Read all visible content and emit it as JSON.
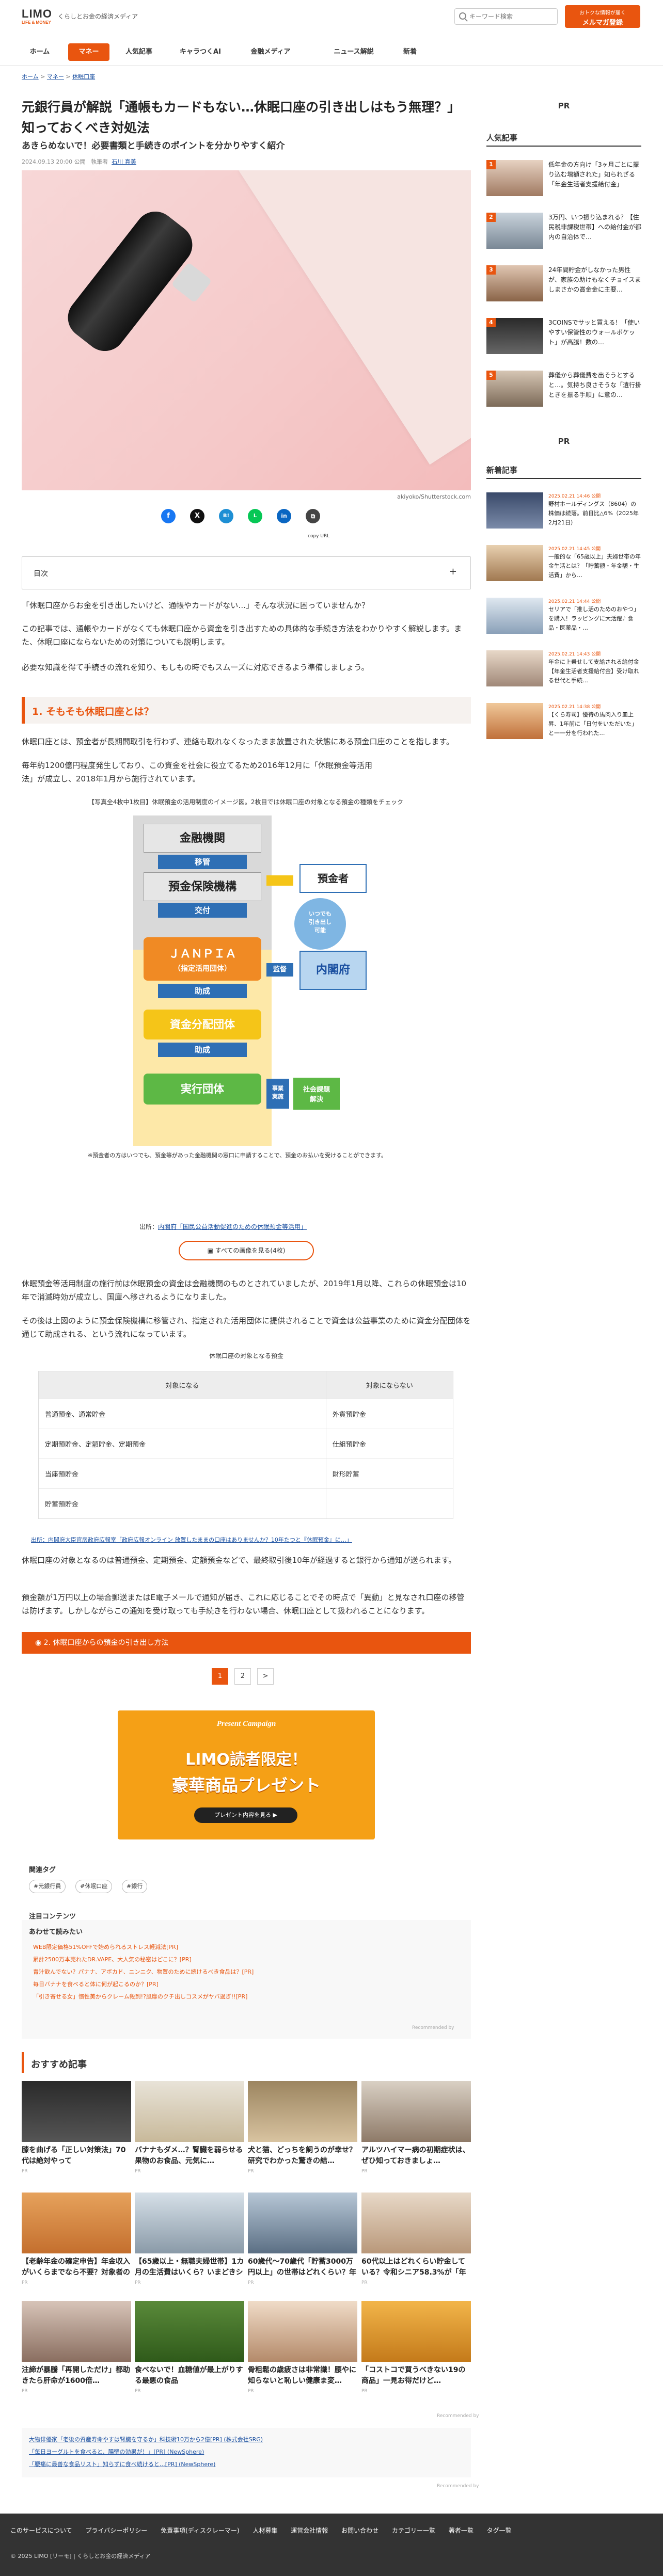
{
  "header": {
    "logo_main": "LIMO",
    "logo_sub": "LIFE & MONEY",
    "tagline": "くらしとお金の経済メディア",
    "search_placeholder": "キーワード検索",
    "mail_top": "おトクな情報が届く",
    "mail_main": "メルマガ登録"
  },
  "nav": {
    "items": [
      "ホーム",
      "マネー",
      "人気記事",
      "キャラつくAI",
      "金融メディア",
      "ニュース解説",
      "新着"
    ]
  },
  "breadcrumb": {
    "home": "ホーム",
    "sep": ">",
    "money": "マネー",
    "current": "休眠口座"
  },
  "article": {
    "title": "元銀行員が解説「通帳もカードもない…休眠口座の引き出しはもう無理？」知っておくべき対処法",
    "subtitle": "あきらめないで！必要書類と手続きのポイントを分かりやすく紹介",
    "date": "2024.09.13 20:00 公開",
    "author_label": "執筆者",
    "author": "石川 真美",
    "photo_credit": "akiyoko/Shutterstock.com",
    "copy_url": "copy URL",
    "toc_label": "目次",
    "toc_toggle": "+",
    "intro1": "「休眠口座からお金を引き出したいけど、通帳やカードがない…」そんな状況に困っていませんか？",
    "intro2": "この記事では、通帳やカードがなくても休眠口座から資金を引き出すための具体的な手続き方法をわかりやすく解説します。また、休眠口座にならないための対策についても説明します。",
    "intro3": "必要な知識を得て手続きの流れを知り、もしもの時でもスムーズに対応できるよう準備しましょう。",
    "h2_1": "1. そもそも休眠口座とは？",
    "p1": "休眠口座とは、預金者が長期間取引を行わず、連絡も取れなくなったまま放置された状態にある預金口座のことを指します。",
    "p2": "毎年約1200億円程度発生しており、この資金を社会に役立てるため2016年12月に「休眠預金等活用法」が成立し、2018年1月から施行されています。",
    "fig1_caption": "【写真全4枚中1枚目】休眠預金の活用制度のイメージ図。2枚目では休眠口座の対象となる預金の種類をチェック",
    "fig1_note": "※預金者の方はいつでも、預金等があった金融機関の窓口に申請することで、預金のお払いを受けることができます。",
    "src_label": "出所：",
    "src_link": "内閣府「国民公益活動促進のための休眠預金等活用」",
    "all_images": "すべての画像を見る(4枚)",
    "p3": "休眠預金等活用制度の施行前は休眠預金の資金は金融機関のものとされていましたが、2019年1月以降、これらの休眠預金は10年で消滅時効が成立し、国庫へ移されるようになりました。",
    "p4": "その後は上図のように預金保険機構に移管され、指定された活用団体に提供されることで資金は公益事業のために資金分配団体を通じて助成される、という流れになっています。",
    "table_caption": "休眠口座の対象となる預金",
    "table_head": [
      "対象になる",
      "対象にならない"
    ],
    "table_rows": [
      [
        "普通預金、通常貯金",
        "外貨預貯金"
      ],
      [
        "定期預貯金、定額貯金、定期預金",
        "仕組預貯金"
      ],
      [
        "当座預貯金",
        "財形貯蓄"
      ],
      [
        "貯蓄預貯金",
        ""
      ]
    ],
    "src2": "出所：内閣府大臣官房政府広報室「政府広報オンライン 放置したままの口座はありませんか？10年たつと『休眠預金』に…」",
    "p5": "休眠口座の対象となるのは普通預金、定期預金、定額預金などで、最終取引後10年が経過すると銀行から通知が送られます。",
    "p6": "預金額が1万円以上の場合郵送またはE電子メールで通知が届き、これに応じることでその時点で「異動」と見なされ口座の移管は防げます。しかしながらこの通知を受け取っても手続きを行わない場合、休眠口座として扱われることになります。",
    "next_section": "2. 休眠口座からの預金の引き出し方法",
    "pages": [
      "1",
      "2",
      ">"
    ]
  },
  "figure1": {
    "bank": "金融機関",
    "move1": "移管",
    "depositor": "預金者",
    "anytime": "いつでも\n引き出し\n可能",
    "dic": "預金保険機構",
    "grant1": "交付",
    "janpia": "ＪＡＮＰＩＡ",
    "janpia_sub": "（指定活用団体）",
    "supervise": "監督",
    "cao": "内閣府",
    "subsidy1": "助成",
    "fund_org": "資金分配団体",
    "subsidy2": "助成",
    "exec_org": "実行団体",
    "biz": "事業\n実施",
    "social": "社会課題\n解決"
  },
  "banner": {
    "campaign": "Present Campaign",
    "line1": "LIMO読者限定！",
    "line2": "豪華商品プレゼント",
    "button": "プレゼント内容を見る ▶"
  },
  "tags": {
    "heading": "関連タグ",
    "items": [
      "#元銀行員",
      "#休眠口座",
      "#銀行"
    ]
  },
  "recommend": {
    "attention": "注目コンテンツ",
    "box_heading": "あわせて読みたい",
    "links": [
      "WEB限定価格51%OFFで始められるストレス軽減法[PR]",
      "累計2500万本売れたDR.VAPE、大人気の秘密はどこに？[PR]",
      "青汁飲んでない？パナナ、アボカド、ニンニク、物置のために続けるべき食品は？[PR]",
      "毎日バナナを食べると体に何が起こるのか？[PR]",
      "「引き寄せる女」慣性美からクレーム殺到!?風靡のクチ出しコスメがヤバ過ぎ!![PR]"
    ],
    "by": "Recommended by"
  },
  "osusume": {
    "heading": "おすすめ記事",
    "cards": [
      {
        "text": "膝を曲げる「正しい対策法」70代は絶対やって",
        "pr": "PR"
      },
      {
        "text": "バナナもダメ…？腎臓を弱らせる果物のお食品、元気に…",
        "pr": "PR"
      },
      {
        "text": "犬と猫、どっちを飼うのが幸せ？研究でわかった驚きの結…",
        "pr": "PR"
      },
      {
        "text": "アルツハイマー病の初期症状は、ぜひ知っておきましょ…",
        "pr": "PR"
      },
      {
        "text": "【老齢年金の確定申告】年金収入がいくらまでなら不要？対象者の条件を…",
        "pr": "PR"
      },
      {
        "text": "【65歳以上・無職夫婦世帯】1カ月の生活費はいくら？いまどきシニアの…",
        "pr": "PR"
      },
      {
        "text": "60歳代～70歳代「貯蓄3000万円以上」の世帯はどれくらい？年金では…",
        "pr": "PR"
      },
      {
        "text": "60代以上はどれくらい貯金している？令和シニア58.3%が「年金だけでは…",
        "pr": "PR"
      },
      {
        "text": "注締が暴騰「再開しただけ」都助きたら肝命が1600倍…",
        "pr": "PR"
      },
      {
        "text": "食べないで！血糖値が最上がりする最悪の食品",
        "pr": "PR"
      },
      {
        "text": "骨粗鬆の歳疲さは非常識！腰やに知らないと恥しい健康ま変…",
        "pr": "PR"
      },
      {
        "text": "「コストコで買うべきない19の商品」一見お得だけど…",
        "pr": "PR"
      }
    ]
  },
  "promo_links": [
    "大物俳優家「老後の資産寿命やすは腎臓を守るか」科技術10万から2億[PR] (株式会社SRG)",
    "「毎日ヨーグルトを食べると、腸壁の効果が！」[PR] (NewSphere)",
    "「腰痛に最善な食品リスト」知らずに食べ続けると…[PR] (NewSphere)"
  ],
  "sidebar": {
    "pr": "PR",
    "popular_heading": "人気記事",
    "popular": [
      {
        "rank": "1",
        "text": "低年金の方向け「3ヶ月ごとに振り込む増額された」知られざる「年金生活者支援給付金」"
      },
      {
        "rank": "2",
        "text": "3万円、いつ振り込まれる？【住民税非課税世帯】への給付金が都内の自治体で…"
      },
      {
        "rank": "3",
        "text": "24年間貯金がしなかった男性が、家族の助けもなくチョイスましまさかの賞金金に主要…"
      },
      {
        "rank": "4",
        "text": "3COINSでサッと買える！「使いやすい保管性のウォールポケット」が高騰！数の…"
      },
      {
        "rank": "5",
        "text": "葬儀から葬儀費を出そうとすると…。気持ち良さそうな「遺行掛ときを振る手順」に意の…"
      }
    ],
    "pr2": "PR",
    "new_heading": "新着記事",
    "newest": [
      {
        "date": "2025.02.21 14:46 公開",
        "text": "野村ホールディングス（8604）の株価は続落。前日比△6%（2025年2月21日）"
      },
      {
        "date": "2025.02.21 14:45 公開",
        "text": "一般的な「65歳以上」夫婦世帯の年金生活とは？「貯蓄額・年金額・生活費」から…"
      },
      {
        "date": "2025.02.21 14:44 公開",
        "text": "セリアで「推し活のためのおやつ」を購入！ラッピングに大活躍♪ 食品・医薬品・…"
      },
      {
        "date": "2025.02.21 14:43 公開",
        "text": "年金に上乗せして支給される給付金【年金生活者支援給付金】受け取れる世代と手続…"
      },
      {
        "date": "2025.02.21 14:38 公開",
        "text": "【くら寿司】優待の馬肉入り皿上昇、1年前に「日付をいただいた」と一一分を行われた…"
      }
    ]
  },
  "footer": {
    "links": [
      "このサービスについて",
      "プライバシーポリシー",
      "免責事項(ディスクレーマー)",
      "人材募集",
      "運営会社情報",
      "お問い合わせ",
      "カテゴリー一覧",
      "著者一覧",
      "タグ一覧"
    ],
    "copyright": "© 2025 LIMO [リーモ] | くらしとお金の経済メディア"
  },
  "colors": {
    "accent": "#e9550f",
    "link": "#1a4fa0"
  }
}
